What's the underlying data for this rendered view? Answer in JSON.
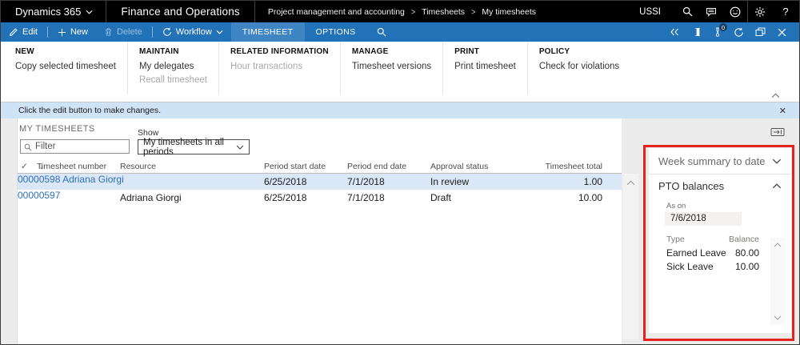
{
  "topbar": {
    "product": "Dynamics 365",
    "app": "Finance and Operations",
    "breadcrumb": [
      "Project management and accounting",
      "Timesheets",
      "My timesheets"
    ],
    "separator": ">",
    "company": "USSI",
    "help": "?"
  },
  "actionbar": {
    "edit": "Edit",
    "new": "New",
    "delete": "Delete",
    "workflow": "Workflow",
    "tabs": [
      "TIMESHEET",
      "OPTIONS"
    ],
    "badge_count": "0"
  },
  "ribbon": {
    "groups": [
      {
        "title": "NEW",
        "items": [
          {
            "label": "Copy selected timesheet"
          }
        ]
      },
      {
        "title": "MAINTAIN",
        "items": [
          {
            "label": "My delegates"
          },
          {
            "label": "Recall timesheet"
          }
        ]
      },
      {
        "title": "RELATED INFORMATION",
        "items": [
          {
            "label": "Hour transactions"
          }
        ]
      },
      {
        "title": "MANAGE",
        "items": [
          {
            "label": "Timesheet versions"
          }
        ]
      },
      {
        "title": "PRINT",
        "items": [
          {
            "label": "Print timesheet"
          }
        ]
      },
      {
        "title": "POLICY",
        "items": [
          {
            "label": "Check for violations"
          }
        ]
      }
    ]
  },
  "notification": {
    "message": "Click the edit button to make changes.",
    "close": "✕"
  },
  "main": {
    "title": "MY TIMESHEETS",
    "filter_placeholder": "Filter",
    "show_label": "Show",
    "show_value": "My timesheets in all periods",
    "table": {
      "select_all": "✓",
      "sort_indicator": "↓",
      "columns": [
        "Timesheet number",
        "Resource",
        "Period start date",
        "Period end date",
        "Approval status",
        "Timesheet total"
      ],
      "rows": [
        {
          "number": "00000598",
          "resource": "Adriana Giorgi",
          "start": "6/25/2018",
          "end": "7/1/2018",
          "status": "In review",
          "total": "1.00"
        },
        {
          "number": "00000597",
          "resource": "Adriana Giorgi",
          "start": "6/25/2018",
          "end": "7/1/2018",
          "status": "Draft",
          "total": "10.00"
        }
      ]
    }
  },
  "factbox": {
    "week_summary_title": "Week summary to date",
    "pto_title": "PTO balances",
    "as_on_label": "As on",
    "as_on_value": "7/6/2018",
    "columns": [
      "Type",
      "Balance"
    ],
    "rows": [
      {
        "type": "Earned Leave",
        "balance": "80.00"
      },
      {
        "type": "Sick Leave",
        "balance": "10.00"
      }
    ]
  },
  "colors": {
    "accent_blue": "#2272b8",
    "active_tab": "#3f85c4",
    "selected_row": "#d9e7f6",
    "notification_bg": "#cee3f6",
    "highlight_red": "#e5221b",
    "link": "#2e71b8"
  }
}
